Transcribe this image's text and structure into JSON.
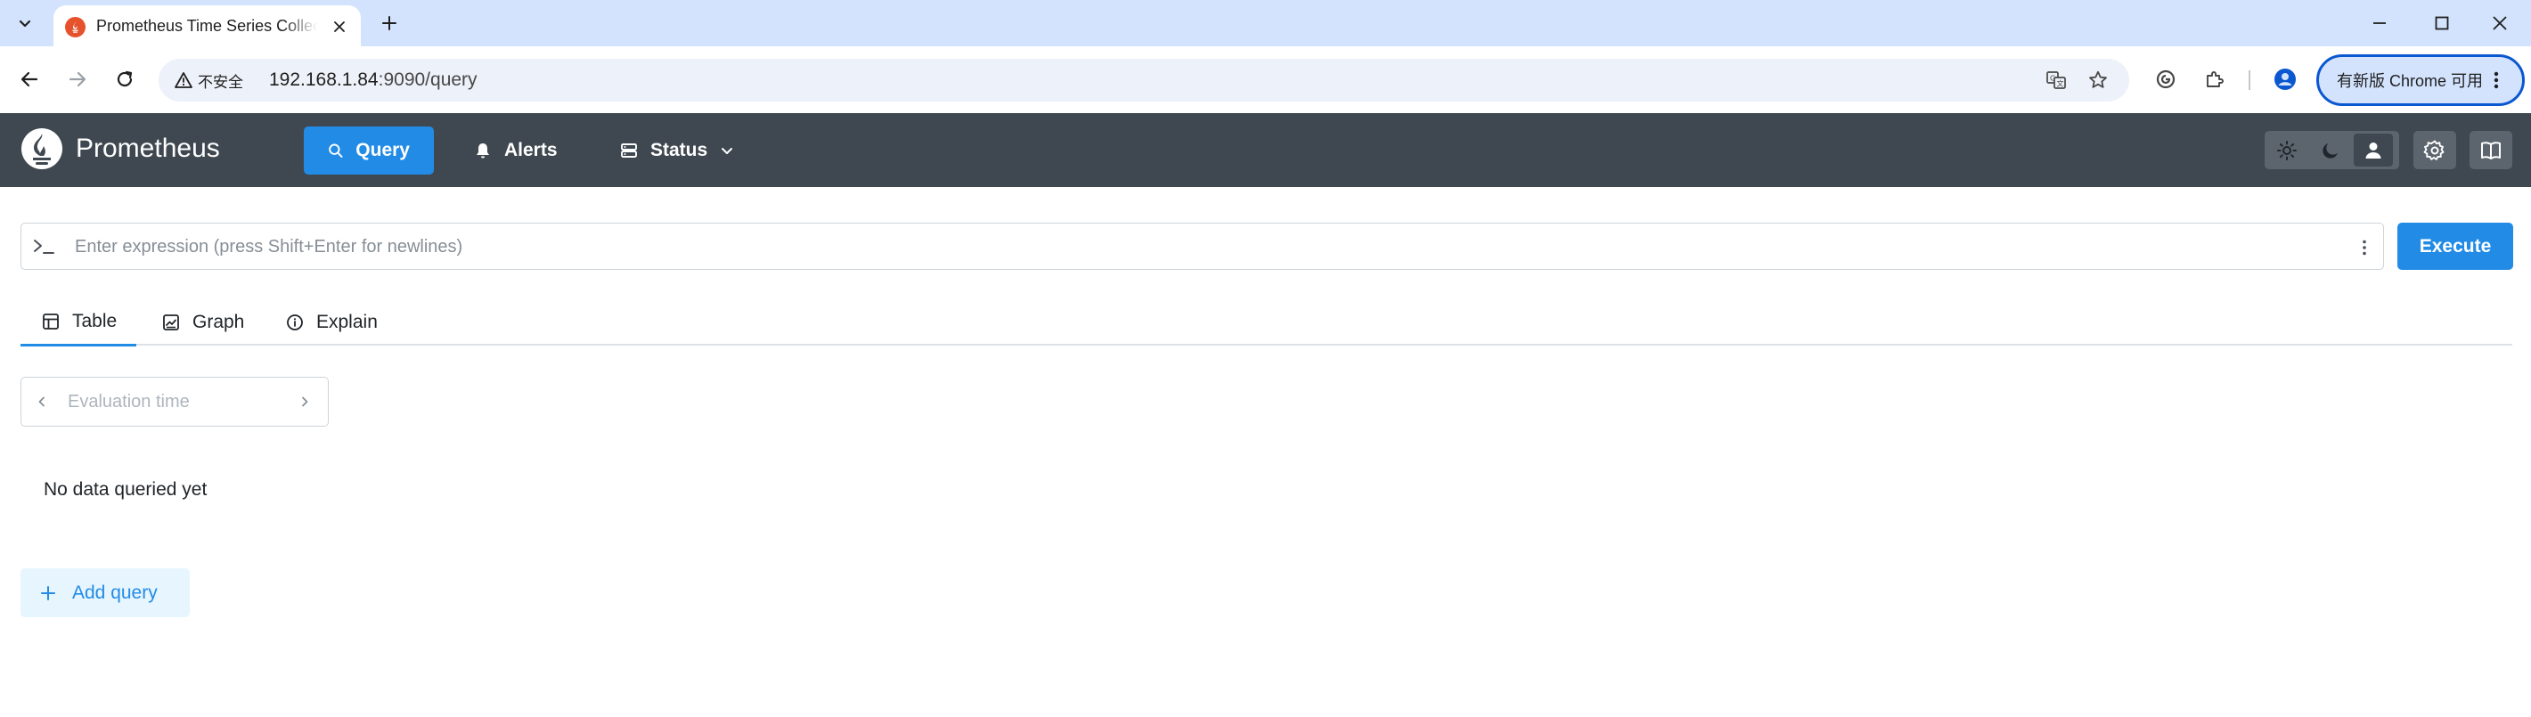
{
  "browser": {
    "tab_title": "Prometheus Time Series Collection and Processing Server",
    "security_label": "不安全",
    "url_host": "192.168.1.84",
    "url_rest": ":9090/query",
    "update_label": "有新版 Chrome 可用"
  },
  "navbar": {
    "brand": "Prometheus",
    "items": [
      {
        "label": "Query",
        "icon": "search-icon"
      },
      {
        "label": "Alerts",
        "icon": "bell-icon"
      },
      {
        "label": "Status",
        "icon": "server-icon"
      }
    ],
    "theme_buttons": [
      "sun-icon",
      "moon-icon",
      "user-icon"
    ],
    "active_theme": "user-icon"
  },
  "query": {
    "expression_placeholder": "Enter expression (press Shift+Enter for newlines)",
    "expression_value": "",
    "execute_label": "Execute",
    "tabs": [
      {
        "label": "Table",
        "icon": "table-icon"
      },
      {
        "label": "Graph",
        "icon": "graph-icon"
      },
      {
        "label": "Explain",
        "icon": "info-icon"
      }
    ],
    "active_tab": "Table",
    "eval_time_placeholder": "Evaluation time",
    "no_data_text": "No data queried yet",
    "add_query_label": "Add query"
  },
  "colors": {
    "accent": "#228be6",
    "navbar_bg": "#3f4850",
    "tabstrip_bg": "#d3e3fd",
    "prometheus_orange": "#e6522c"
  }
}
